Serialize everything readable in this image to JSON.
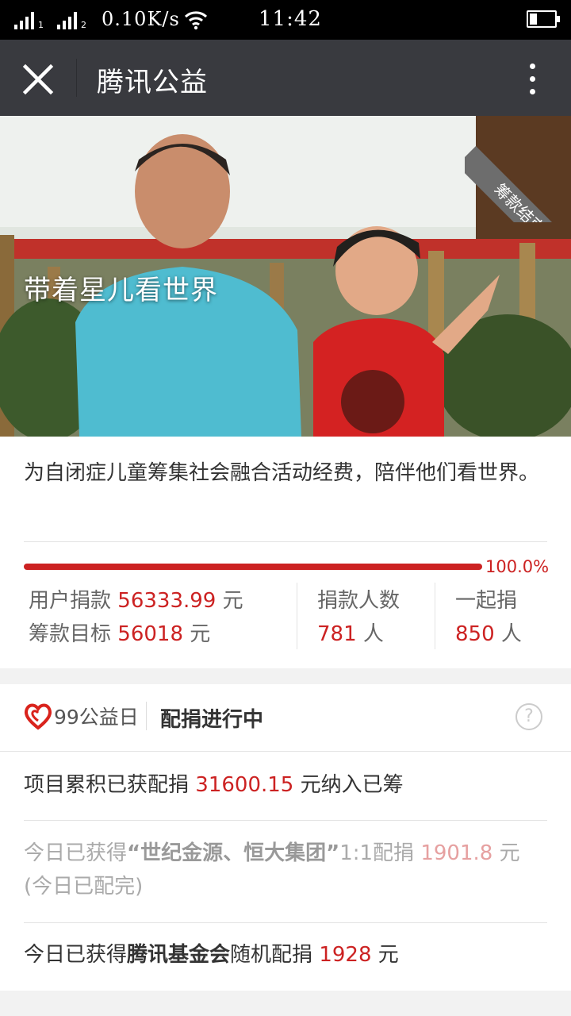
{
  "status_bar": {
    "sim1": "1",
    "sim2": "2",
    "network_speed": "0.10K/s",
    "time": "11:42",
    "battery_level": 0.3
  },
  "title_bar": {
    "title": "腾讯公益"
  },
  "hero": {
    "title": "带着星儿看世界",
    "ribbon": "筹款结束"
  },
  "project": {
    "description": "为自闭症儿童筹集社会融合活动经费，陪伴他们看世界。",
    "progress_percent": 100,
    "progress_label": "100.0%",
    "donated_label": "用户捐款",
    "donated_value": "56333.99",
    "goal_label": "筹款目标",
    "goal_value": "56018",
    "unit": "元",
    "donors_label": "捐款人数",
    "donors_value": "781",
    "together_label": "一起捐",
    "together_value": "850",
    "person_unit": "人"
  },
  "match": {
    "logo_text": "99公益日",
    "status": "配捐进行中",
    "help": "?",
    "line1_prefix": "项目累积已获配捐",
    "line1_value": "31600.15",
    "line1_suffix": "元纳入已筹",
    "line2_prefix": "今日已获得",
    "line2_company": "“世纪金源、恒大集团”",
    "line2_mid": "1:1配捐",
    "line2_value": "1901.8",
    "line2_unit": "元",
    "line2_note": "(今日已配完)",
    "line3_prefix": "今日已获得",
    "line3_org": "腾讯基金会",
    "line3_mid": "随机配捐",
    "line3_value": "1928",
    "line3_unit": "元"
  },
  "colors": {
    "accent": "#cc2222",
    "titlebar": "#393a3f"
  }
}
